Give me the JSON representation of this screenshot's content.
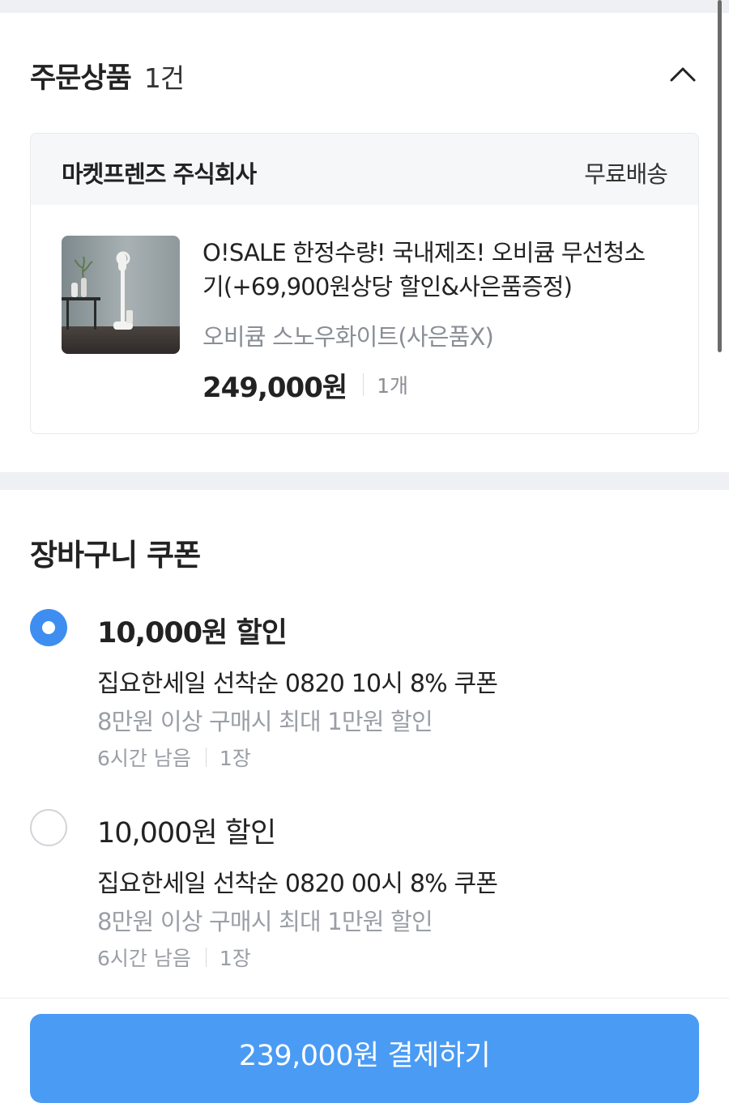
{
  "order": {
    "title": "주문상품",
    "count": "1건",
    "seller": "마켓프렌즈 주식회사",
    "shipping": "무료배송",
    "product": {
      "name_line1": "O!SALE 한정수량! 국내제조! 오비큠 무선청소",
      "name_line2": "기(+69,900원상당 할인&사은품증정)",
      "option": "오비큠 스노우화이트(사은품X)",
      "price": "249,000원",
      "quantity": "1개",
      "thumbnail_icon": "vacuum-product-photo"
    }
  },
  "coupons": {
    "title": "장바구니 쿠폰",
    "items": [
      {
        "amount": "10,000원 할인",
        "name": "집요한세일 선착순 0820 10시 8% 쿠폰",
        "condition": "8만원 이상 구매시 최대 1만원 할인",
        "remaining": "6시간 남음",
        "count": "1장",
        "selected": true
      },
      {
        "amount": "10,000원 할인",
        "name": "집요한세일 선착순 0820 00시 8% 쿠폰",
        "condition": "8만원 이상 구매시 최대 1만원 할인",
        "remaining": "6시간 남음",
        "count": "1장",
        "selected": false
      }
    ]
  },
  "checkout": {
    "button_label": "239,000원 결제하기"
  },
  "colors": {
    "accent": "#4a9bf4",
    "radio_selected": "#3d8ef0",
    "section_band": "#eef0f3"
  }
}
